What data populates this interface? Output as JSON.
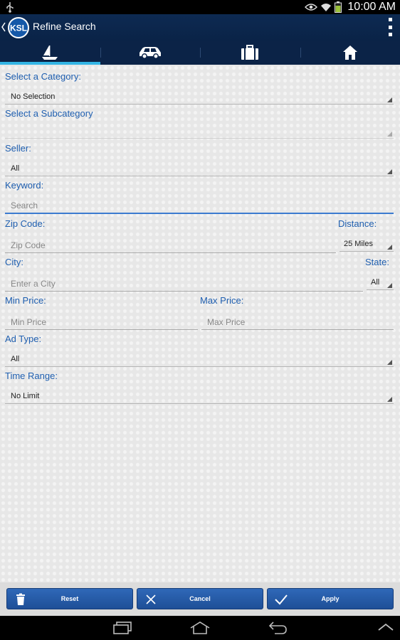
{
  "status_bar": {
    "time": "10:00 AM"
  },
  "action_bar": {
    "logo_text": "KSL",
    "title": "Refine Search"
  },
  "tabs": [
    {
      "icon": "sailboat-icon"
    },
    {
      "icon": "car-icon"
    },
    {
      "icon": "briefcase-icon"
    },
    {
      "icon": "home-icon"
    }
  ],
  "form": {
    "category": {
      "label": "Select a Category:",
      "value": "No Selection"
    },
    "subcategory": {
      "label": "Select a Subcategory",
      "value": ""
    },
    "seller": {
      "label": "Seller:",
      "value": "All"
    },
    "keyword": {
      "label": "Keyword:",
      "placeholder": "Search"
    },
    "zip": {
      "label": "Zip Code:",
      "placeholder": "Zip Code"
    },
    "distance": {
      "label": "Distance:",
      "value": "25 Miles"
    },
    "city": {
      "label": "City:",
      "placeholder": "Enter a City"
    },
    "state": {
      "label": "State:",
      "value": "All"
    },
    "min_price": {
      "label": "Min Price:",
      "placeholder": "Min Price"
    },
    "max_price": {
      "label": "Max Price:",
      "placeholder": "Max Price"
    },
    "ad_type": {
      "label": "Ad Type:",
      "value": "All"
    },
    "time_range": {
      "label": "Time Range:",
      "value": "No Limit"
    }
  },
  "buttons": {
    "reset": "Reset",
    "cancel": "Cancel",
    "apply": "Apply"
  },
  "colors": {
    "label_blue": "#1f5fb0",
    "accent": "#33b5e5",
    "button_blue": "#2a61b1",
    "header_navy": "#0b2347"
  }
}
